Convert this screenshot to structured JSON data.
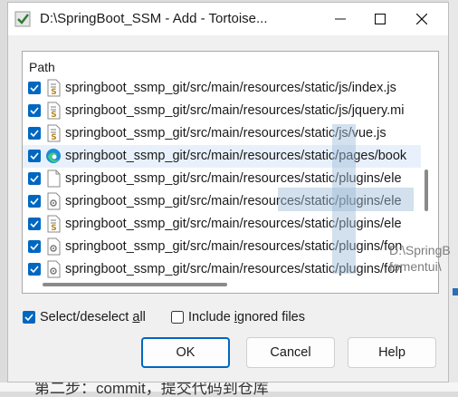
{
  "window": {
    "title": "D:\\SpringBoot_SSM - Add - Tortoise..."
  },
  "list": {
    "column_header": "Path",
    "rows": [
      {
        "path": "springboot_ssmp_git/src/main/resources/static/js/index.js",
        "checked": true,
        "icon": "js-file-icon"
      },
      {
        "path": "springboot_ssmp_git/src/main/resources/static/js/jquery.mi",
        "checked": true,
        "icon": "js-file-icon"
      },
      {
        "path": "springboot_ssmp_git/src/main/resources/static/js/vue.js",
        "checked": true,
        "icon": "js-file-icon"
      },
      {
        "path": "springboot_ssmp_git/src/main/resources/static/pages/book",
        "checked": true,
        "icon": "edge-browser-icon"
      },
      {
        "path": "springboot_ssmp_git/src/main/resources/static/plugins/ele",
        "checked": true,
        "icon": "blank-file-icon"
      },
      {
        "path": "springboot_ssmp_git/src/main/resources/static/plugins/ele",
        "checked": true,
        "icon": "settings-file-icon"
      },
      {
        "path": "springboot_ssmp_git/src/main/resources/static/plugins/ele",
        "checked": true,
        "icon": "js-file-icon"
      },
      {
        "path": "springboot_ssmp_git/src/main/resources/static/plugins/fon",
        "checked": true,
        "icon": "settings-file-icon"
      },
      {
        "path": "springboot_ssmp_git/src/main/resources/static/plugins/fon",
        "checked": true,
        "icon": "settings-file-icon"
      }
    ]
  },
  "options": {
    "select_all": {
      "pre": "Select/deselect ",
      "accel": "a",
      "post": "ll",
      "checked": true
    },
    "include_ignored": {
      "pre": "Include ",
      "accel": "i",
      "post": "gnored files",
      "checked": false
    }
  },
  "buttons": {
    "ok": "OK",
    "cancel": "Cancel",
    "help": "Help"
  },
  "background": {
    "ghost_1": "D:\\SpringB",
    "ghost_2": "fomentui\\",
    "bottom_text": "第二步：commit，提交代码到仓库"
  },
  "colors": {
    "accent": "#0067c0",
    "hover_row": "#e8f1fb"
  }
}
